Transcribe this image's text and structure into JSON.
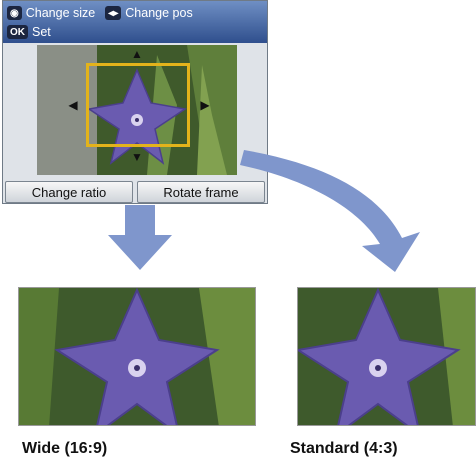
{
  "lcd": {
    "header": {
      "change_size_key": "◉",
      "change_size_label": "Change size",
      "change_pos_key": "◂▸",
      "change_pos_label": "Change pos",
      "set_key": "OK",
      "set_label": "Set"
    },
    "footer": {
      "left_button": "Change ratio",
      "right_button": "Rotate frame"
    }
  },
  "results": {
    "wide_caption": "Wide (16:9)",
    "standard_caption": "Standard (4:3)"
  },
  "colors": {
    "frame": "#e3b31b",
    "arrow": "#7f96cc",
    "petal": "#6a5bb0"
  }
}
